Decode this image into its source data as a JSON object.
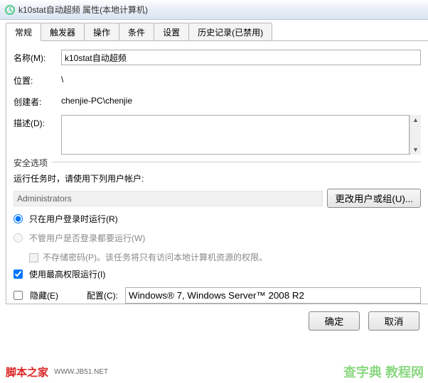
{
  "title": "k10stat自动超频 属性(本地计算机)",
  "tabs": [
    "常规",
    "触发器",
    "操作",
    "条件",
    "设置",
    "历史记录(已禁用)"
  ],
  "labels": {
    "name": "名称(M):",
    "location": "位置:",
    "author": "创建者:",
    "description": "描述(D):"
  },
  "values": {
    "name": "k10stat自动超频",
    "location": "\\",
    "author": "chenjie-PC\\chenjie",
    "description": ""
  },
  "security": {
    "legend": "安全选项",
    "prompt": "运行任务时，请使用下列用户帐户:",
    "account": "Administrators",
    "changeBtn": "更改用户或组(U)...",
    "radio1": "只在用户登录时运行(R)",
    "radio2": "不管用户是否登录都要运行(W)",
    "noStore": "不存储密码(P)。该任务将只有访问本地计算机资源的权限。",
    "highest": "使用最高权限运行(I)"
  },
  "bottom": {
    "hidden": "隐藏(E)",
    "configLabel": "配置(C):",
    "configValue": "Windows® 7, Windows Server™ 2008 R2"
  },
  "buttons": {
    "ok": "确定",
    "cancel": "取消"
  },
  "footer": {
    "brand": "脚本之家",
    "url": "WWW.JB51.NET"
  },
  "watermark": "查字典\n  教程网"
}
